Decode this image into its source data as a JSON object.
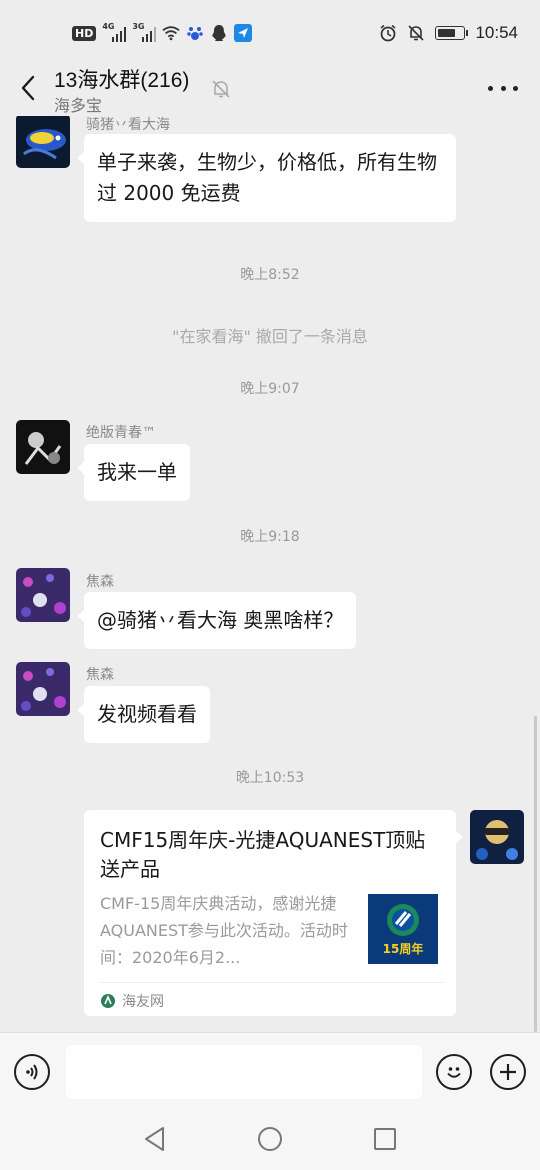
{
  "status_bar": {
    "left_badge": "HD",
    "signal1_gen": "4G",
    "signal2_gen": "3G",
    "time": "10:54"
  },
  "header": {
    "title": "13海水群(216)",
    "subtitle": "海多宝"
  },
  "messages": [
    {
      "sender": "骑猪丷看大海",
      "text": "单子来袭，生物少，价格低，所有生物过 2000 免运费"
    },
    {
      "time": "晚上8:52"
    },
    {
      "recall_notice": "\"在家看海\" 撤回了一条消息"
    },
    {
      "time": "晚上9:07"
    },
    {
      "sender": "绝版青春™",
      "text": "我来一单"
    },
    {
      "time": "晚上9:18"
    },
    {
      "sender": "焦森",
      "text": "@骑猪丷看大海 奥黑啥样？"
    },
    {
      "sender": "焦森",
      "text": "发视频看看"
    },
    {
      "time": "晚上10:53"
    }
  ],
  "link_card": {
    "title": "CMF15周年庆-光捷AQUANEST顶贴送产品",
    "description": "CMF-15周年庆典活动，感谢光捷AQUANEST参与此次活动。活动时间：2020年6月2...",
    "thumb_text": "15周年",
    "source": "海友网"
  },
  "input": {
    "value": "",
    "placeholder": ""
  },
  "colors": {
    "background": "#ededed",
    "bubble": "#ffffff",
    "time_text": "#9a9a9a"
  },
  "icons": {
    "back": "chevron-left-icon",
    "mute": "bell-off-icon",
    "more": "more-dots-icon",
    "voice": "voice-icon",
    "emoji": "emoji-icon",
    "add": "plus-icon",
    "nav_back": "triangle-back-icon",
    "nav_home": "circle-home-icon",
    "nav_recent": "square-recent-icon"
  }
}
